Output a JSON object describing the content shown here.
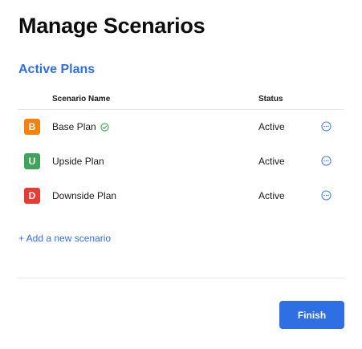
{
  "dialog": {
    "title": "Manage Scenarios",
    "section_title": "Active Plans"
  },
  "table": {
    "columns": {
      "name": "Scenario Name",
      "status": "Status"
    },
    "rows": [
      {
        "letter": "B",
        "name": "Base Plan",
        "status": "Active",
        "color": "#f5820d",
        "is_base": true
      },
      {
        "letter": "U",
        "name": "Upside Plan",
        "status": "Active",
        "color": "#3fa35a",
        "is_base": false
      },
      {
        "letter": "D",
        "name": "Downside Plan",
        "status": "Active",
        "color": "#e53c35",
        "is_base": false
      }
    ]
  },
  "actions": {
    "add_label": "+ Add a new scenario",
    "finish_label": "Finish"
  },
  "icons": {
    "base_marker": "check-circle-icon",
    "row_menu": "more-horizontal-circle-icon"
  },
  "colors": {
    "accent": "#2f6fe4",
    "check": "#3fa35a"
  }
}
